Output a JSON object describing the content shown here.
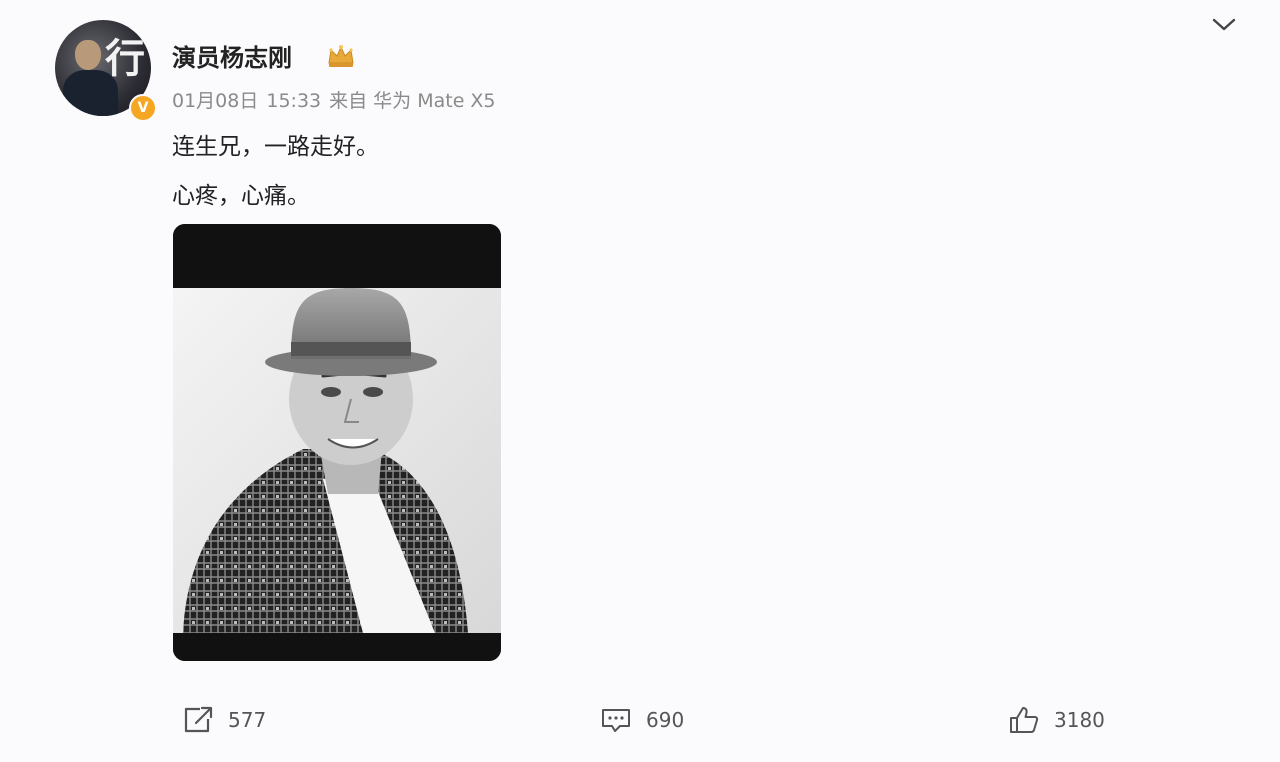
{
  "post": {
    "author": {
      "name": "演员杨志刚",
      "avatar_glyph": "行",
      "verified_mark": "V"
    },
    "meta": {
      "date": "01月08日",
      "time": "15:33",
      "source": "来自 华为 Mate X5"
    },
    "text_lines": [
      "连生兄，一路走好。",
      "心疼，心痛。"
    ],
    "actions": {
      "repost_count": "577",
      "comment_count": "690",
      "like_count": "3180"
    }
  },
  "colors": {
    "background": "#fbfbfd",
    "verified": "#f5a623",
    "meta_text": "#8a8a8a",
    "crown": "#e8a93a"
  }
}
